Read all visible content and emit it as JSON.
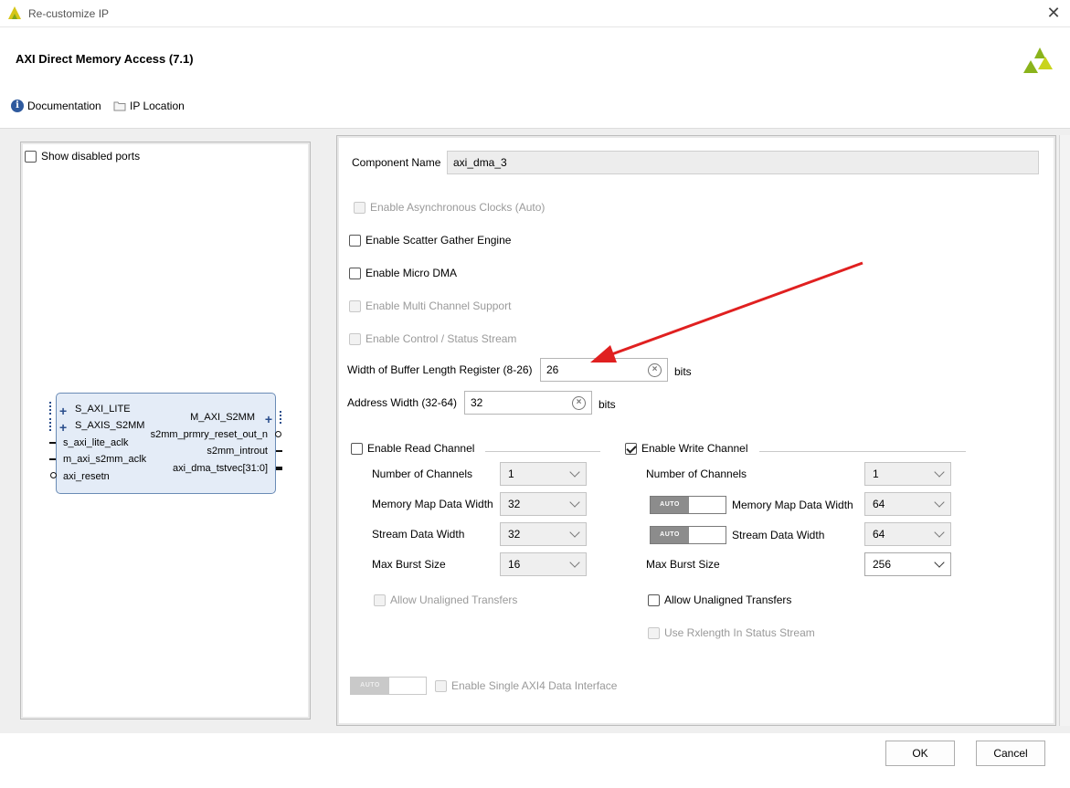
{
  "window": {
    "title": "Re-customize IP"
  },
  "header": {
    "title": "AXI Direct Memory Access (7.1)",
    "documentation_label": "Documentation",
    "ip_location_label": "IP Location"
  },
  "left_panel": {
    "show_disabled_ports_label": "Show disabled ports",
    "block": {
      "left_ports": [
        {
          "label": "S_AXI_LITE",
          "kind": "bus"
        },
        {
          "label": "S_AXIS_S2MM",
          "kind": "bus"
        },
        {
          "label": "s_axi_lite_aclk",
          "kind": "pin"
        },
        {
          "label": "m_axi_s2mm_aclk",
          "kind": "pin"
        },
        {
          "label": "axi_resetn",
          "kind": "inverted"
        }
      ],
      "right_ports": [
        {
          "label": "M_AXI_S2MM",
          "kind": "bus"
        },
        {
          "label": "s2mm_prmry_reset_out_n",
          "kind": "inverted"
        },
        {
          "label": "s2mm_introut",
          "kind": "pin"
        },
        {
          "label": "axi_dma_tstvec[31:0]",
          "kind": "bus-pin"
        }
      ]
    }
  },
  "config": {
    "component_name_label": "Component Name",
    "component_name_value": "axi_dma_3",
    "async_clocks_label": "Enable Asynchronous Clocks (Auto)",
    "scatter_gather_label": "Enable Scatter Gather Engine",
    "micro_dma_label": "Enable Micro DMA",
    "multi_channel_label": "Enable Multi Channel Support",
    "control_status_label": "Enable Control / Status Stream",
    "buffer_length_label": "Width of Buffer Length Register (8-26)",
    "buffer_length_value": "26",
    "buffer_length_unit": "bits",
    "address_width_label": "Address Width (32-64)",
    "address_width_value": "32",
    "address_width_unit": "bits",
    "single_axi4_label": "Enable Single AXI4 Data Interface",
    "auto_label": "AUTO"
  },
  "read_channel": {
    "enable_label": "Enable Read Channel",
    "enabled": false,
    "num_channels_label": "Number of Channels",
    "num_channels_value": "1",
    "mm_data_width_label": "Memory Map Data Width",
    "mm_data_width_value": "32",
    "stream_data_width_label": "Stream Data Width",
    "stream_data_width_value": "32",
    "max_burst_label": "Max Burst Size",
    "max_burst_value": "16",
    "unaligned_label": "Allow Unaligned Transfers"
  },
  "write_channel": {
    "enable_label": "Enable Write Channel",
    "enabled": true,
    "num_channels_label": "Number of Channels",
    "num_channels_value": "1",
    "mm_data_width_label": "Memory Map Data Width",
    "mm_data_width_value": "64",
    "stream_data_width_label": "Stream Data Width",
    "stream_data_width_value": "64",
    "max_burst_label": "Max Burst Size",
    "max_burst_value": "256",
    "unaligned_label": "Allow Unaligned Transfers",
    "rxlength_label": "Use Rxlength In Status Stream"
  },
  "buttons": {
    "ok": "OK",
    "cancel": "Cancel"
  },
  "colors": {
    "annotation_arrow": "#e02020",
    "block_fill": "#e4ecf7",
    "brand_logo": "#8ab31b"
  }
}
